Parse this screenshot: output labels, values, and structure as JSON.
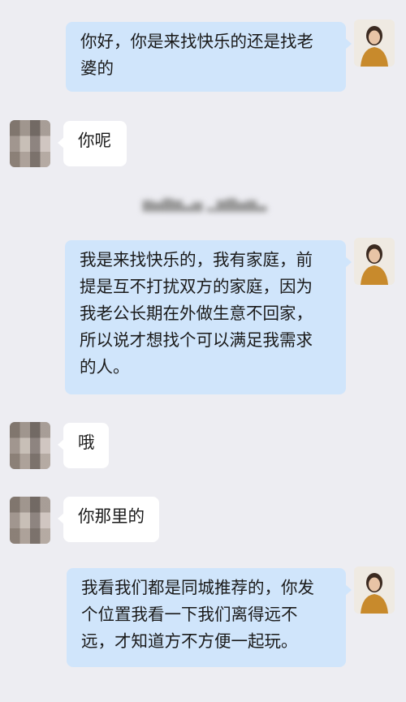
{
  "timestamp": "",
  "messages": [
    {
      "side": "me",
      "text": "你好，你是来找快乐的还是找老\n婆的"
    },
    {
      "side": "other",
      "text": "你呢"
    },
    {
      "side": "me",
      "text": "我是来找快乐的，我有家庭，前\n提是互不打扰双方的家庭，因为\n我老公长期在外做生意不回家，\n所以说才想找个可以满足我需求\n的人。"
    },
    {
      "side": "other",
      "text": "哦"
    },
    {
      "side": "other",
      "text": "你那里的"
    },
    {
      "side": "me",
      "text": "我看我们都是同城推荐的，你发\n个位置我看一下我们离得远不\n远，才知道方不方便一起玩。"
    }
  ]
}
